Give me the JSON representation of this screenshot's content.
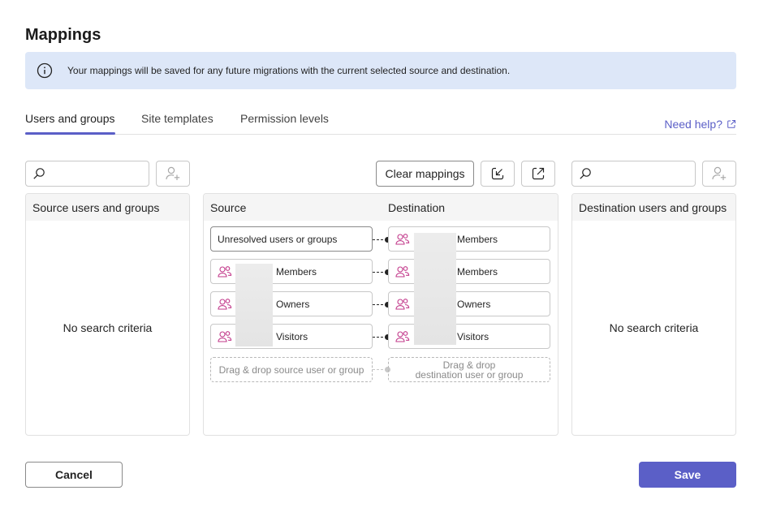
{
  "page": {
    "title": "Mappings"
  },
  "banner": {
    "icon": "info-icon",
    "text": "Your mappings will be saved for any future migrations with the current selected source and destination."
  },
  "tabs": [
    {
      "label": "Users and groups",
      "active": true
    },
    {
      "label": "Site templates",
      "active": false
    },
    {
      "label": "Permission levels",
      "active": false
    }
  ],
  "help": {
    "label": "Need help?",
    "icon": "external-link-icon"
  },
  "toolbar": {
    "source_search_placeholder": "",
    "destination_search_placeholder": "",
    "clear_label": "Clear mappings",
    "import_icon": "import-icon",
    "export_icon": "export-icon",
    "add_user_icon": "add-person-icon"
  },
  "source_panel": {
    "header": "Source users and groups",
    "empty_text": "No search criteria"
  },
  "mapping_panel": {
    "source_header": "Source",
    "destination_header": "Destination",
    "rows": [
      {
        "source": "Unresolved users or groups",
        "destination": "Members"
      },
      {
        "source": "Members",
        "destination": "Members"
      },
      {
        "source": "Owners",
        "destination": "Owners"
      },
      {
        "source": "Visitors",
        "destination": "Visitors"
      }
    ],
    "source_drop": "Drag & drop source user or group",
    "destination_drop_line1": "Drag & drop",
    "destination_drop_line2": "destination user or group"
  },
  "destination_panel": {
    "header": "Destination users and groups",
    "empty_text": "No search criteria"
  },
  "footer": {
    "cancel_label": "Cancel",
    "save_label": "Save"
  },
  "colors": {
    "accent": "#5b5fc7",
    "banner_bg": "#dde7f8",
    "people_icon": "#c2388a"
  }
}
